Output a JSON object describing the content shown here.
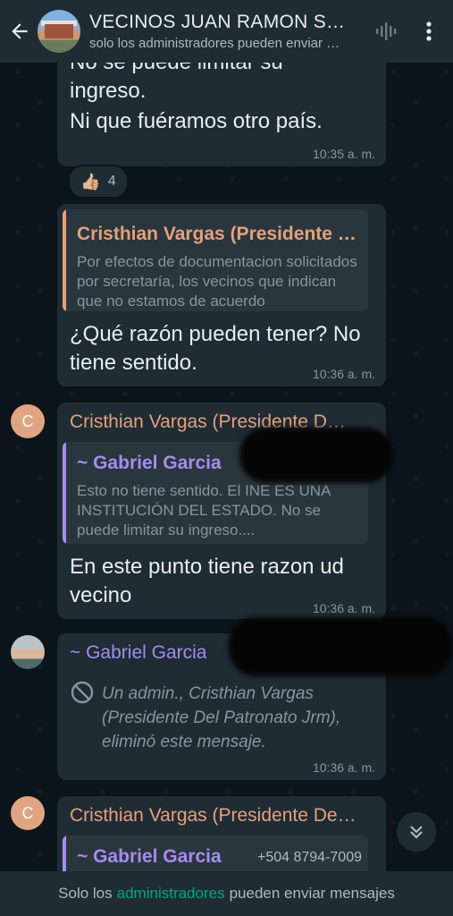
{
  "header": {
    "title": "VECINOS JUAN RAMON SOLER",
    "subtitle": "solo los administradores pueden enviar mensajes"
  },
  "messages": {
    "m1": {
      "cut_line": "No se puede limitar su",
      "line2": "ingreso.",
      "line3": "Ni que fuéramos otro país.",
      "time": "10:35 a. m.",
      "reaction_emoji": "👍🏼",
      "reaction_count": "4"
    },
    "m2": {
      "quote_author": "Cristhian Vargas (Presidente Del Patronato Jrm)",
      "quote_text": "Por efectos de documentacion solicitados por secretaría, los vecinos que indican que no estamos de acuerdo",
      "text": "¿Qué razón pueden tener? No tiene sentido.",
      "time": "10:36 a. m."
    },
    "m3": {
      "avatar_letter": "C",
      "sender": "Cristhian Vargas (Presidente Del Patronato Jrm)",
      "quote_author": "~ Gabriel Garcia",
      "quote_text": "Esto no tiene sentido. El INE ES UNA INSTITUCIÓN DEL ESTADO. No se puede limitar su ingreso....",
      "text": "En este punto tiene razon ud vecino",
      "time": "10:36 a. m."
    },
    "m4": {
      "sender": "~ Gabriel Garcia",
      "deleted_text": "Un admin., Cristhian Vargas (Presidente Del Patronato Jrm), eliminó este mensaje.",
      "time": "10:36 a. m."
    },
    "m5": {
      "avatar_letter": "C",
      "sender": "Cristhian Vargas (Presidente Del Patronato Jrm)",
      "quote_author": "~ Gabriel Garcia",
      "quote_phone": "+504 8794-7009"
    }
  },
  "footer": {
    "before": "Solo los",
    "link": "administradores",
    "after": "pueden enviar mensajes"
  },
  "colors": {
    "background": "#0b141a",
    "bubble": "#1f2c34",
    "accent_green": "#00a884",
    "sender_orange": "#e7a07a",
    "quote_purple": "#a58cf0"
  },
  "icons": [
    "back-arrow-icon",
    "voice-call-icon",
    "more-vert-icon",
    "thumbs-up-icon",
    "blocked-icon",
    "double-chevron-down-icon"
  ]
}
